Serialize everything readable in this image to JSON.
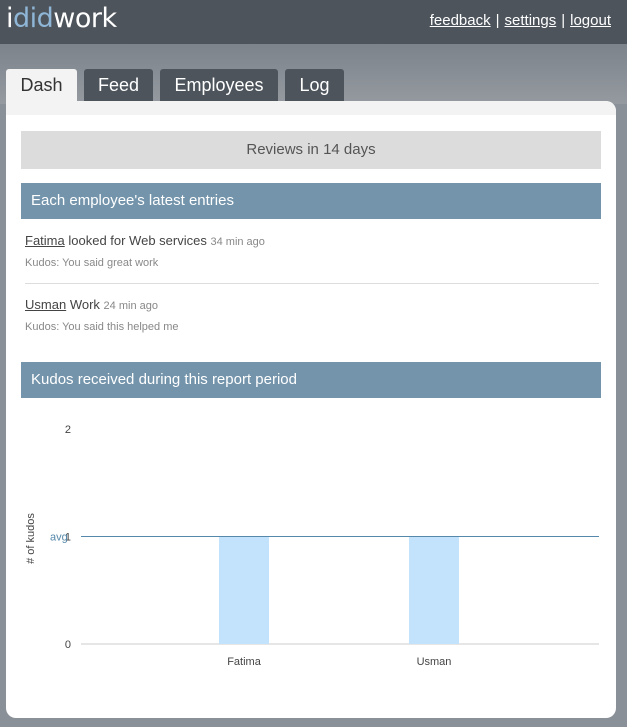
{
  "app": {
    "logo_part1": "i",
    "logo_part2": "did",
    "logo_part3": "work"
  },
  "toplinks": {
    "feedback": "feedback",
    "settings": "settings",
    "logout": "logout",
    "separator": "|"
  },
  "tabs": [
    {
      "label": "Dash",
      "active": true
    },
    {
      "label": "Feed",
      "active": false
    },
    {
      "label": "Employees",
      "active": false
    },
    {
      "label": "Log",
      "active": false
    }
  ],
  "banner": "Reviews in 14 days",
  "latest": {
    "title": "Each employee's latest entries",
    "entries": [
      {
        "name": "Fatima",
        "text": "looked for Web services",
        "ago": "34 min ago",
        "kudos": "Kudos: You said great work"
      },
      {
        "name": "Usman",
        "text": "Work",
        "ago": "24 min ago",
        "kudos": "Kudos: You said this helped me"
      }
    ]
  },
  "kudos_section": {
    "title": "Kudos received during this report period"
  },
  "colors": {
    "header_bg": "#4d545c",
    "section_bg": "#7394ab",
    "bar_fill": "#c2e3fb",
    "avg_line": "#5588aa",
    "logo_accent": "#8fb6d6"
  },
  "chart_data": {
    "type": "bar",
    "categories": [
      "Fatima",
      "Usman"
    ],
    "values": [
      1,
      1
    ],
    "ylabel": "# of kudos",
    "ylim": [
      0,
      2
    ],
    "yticks": [
      "0",
      "1",
      "2"
    ],
    "avg": 1,
    "avg_label": "avg",
    "grid": false
  }
}
